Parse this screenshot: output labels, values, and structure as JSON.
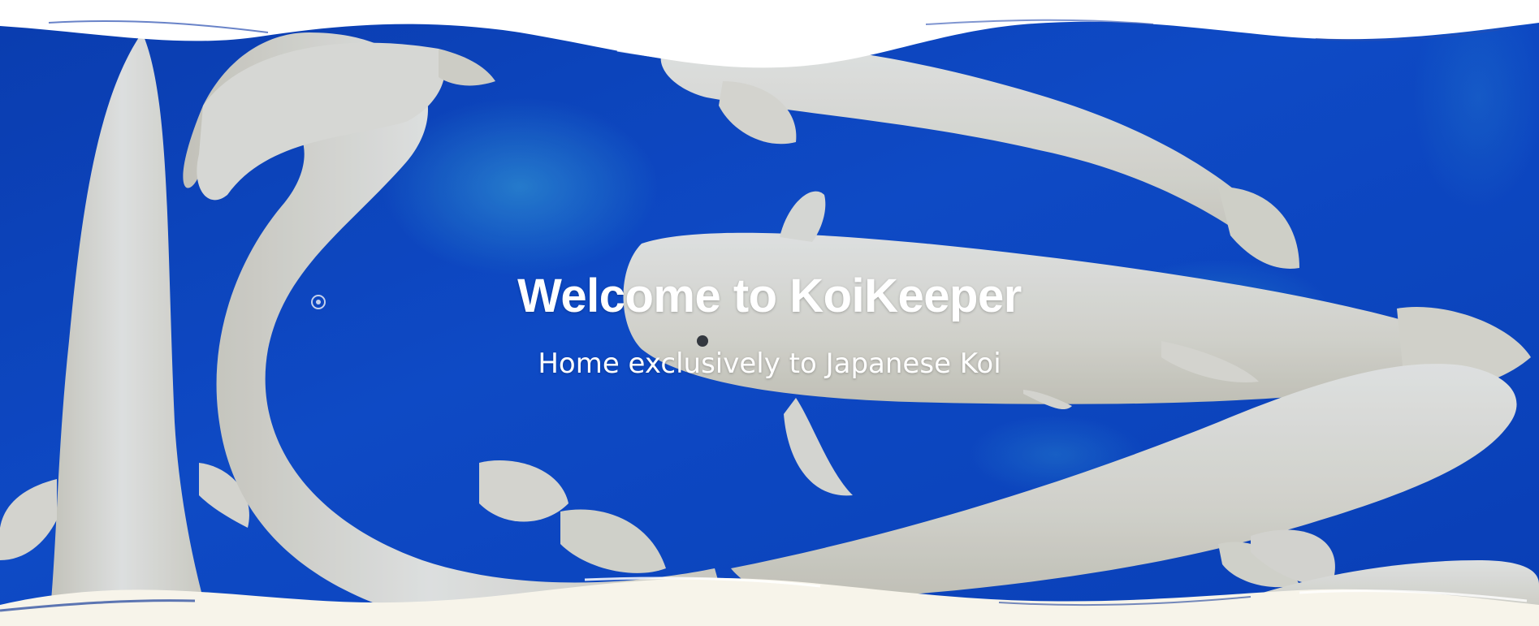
{
  "hero": {
    "title": "Welcome to KoiKeeper",
    "subtitle": "Home exclusively to Japanese Koi",
    "background_image": "white-koi-in-blue-pond-photo",
    "colors": {
      "water": "#0d47c9",
      "koi": "#f4f1e6",
      "text": "#ffffff",
      "bottom_wave": "#f7f4ea",
      "top_wave": "#ffffff"
    }
  }
}
